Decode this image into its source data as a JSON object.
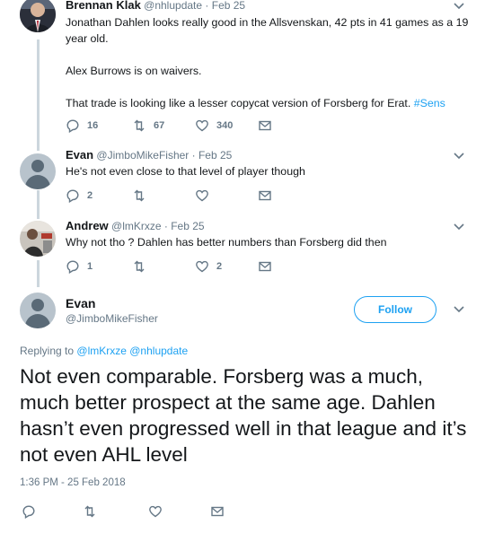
{
  "tweets": [
    {
      "name": "Brennan Klak",
      "handle": "@nhlupdate",
      "date": "· Feb 25",
      "lines": [
        "Jonathan Dahlen looks really good in the Allsvenskan, 42 pts in 41 games as a 19",
        "year old.",
        "",
        "Alex Burrows is on waivers.",
        "",
        "That trade is looking like a lesser copycat version of Forsberg for Erat."
      ],
      "hashtag": "#Sens",
      "reply_count": "16",
      "retweet_count": "67",
      "like_count": "340"
    },
    {
      "name": "Evan",
      "handle": "@JimboMikeFisher",
      "date": "· Feb 25",
      "text": "He's not even close to that level of player though",
      "reply_count": "2",
      "retweet_count": "",
      "like_count": ""
    },
    {
      "name": "Andrew",
      "handle": "@lmKrxze",
      "date": "· Feb 25",
      "text": "Why not tho ? Dahlen has better numbers than Forsberg did then",
      "reply_count": "1",
      "retweet_count": "",
      "like_count": "2"
    }
  ],
  "main": {
    "name": "Evan",
    "handle": "@JimboMikeFisher",
    "follow_label": "Follow",
    "replying_prefix": "Replying to",
    "replying_to": "@lmKrxze @nhlupdate",
    "text": "Not even comparable. Forsberg was a much, much better prospect at the same age. Dahlen hasn’t even progressed well in that league and it’s not even AHL level",
    "timestamp": "1:36 PM - 25 Feb 2018"
  },
  "colors": {
    "accent": "#1da1f2",
    "muted": "#657786",
    "thread_line": "#ccd6dd"
  }
}
